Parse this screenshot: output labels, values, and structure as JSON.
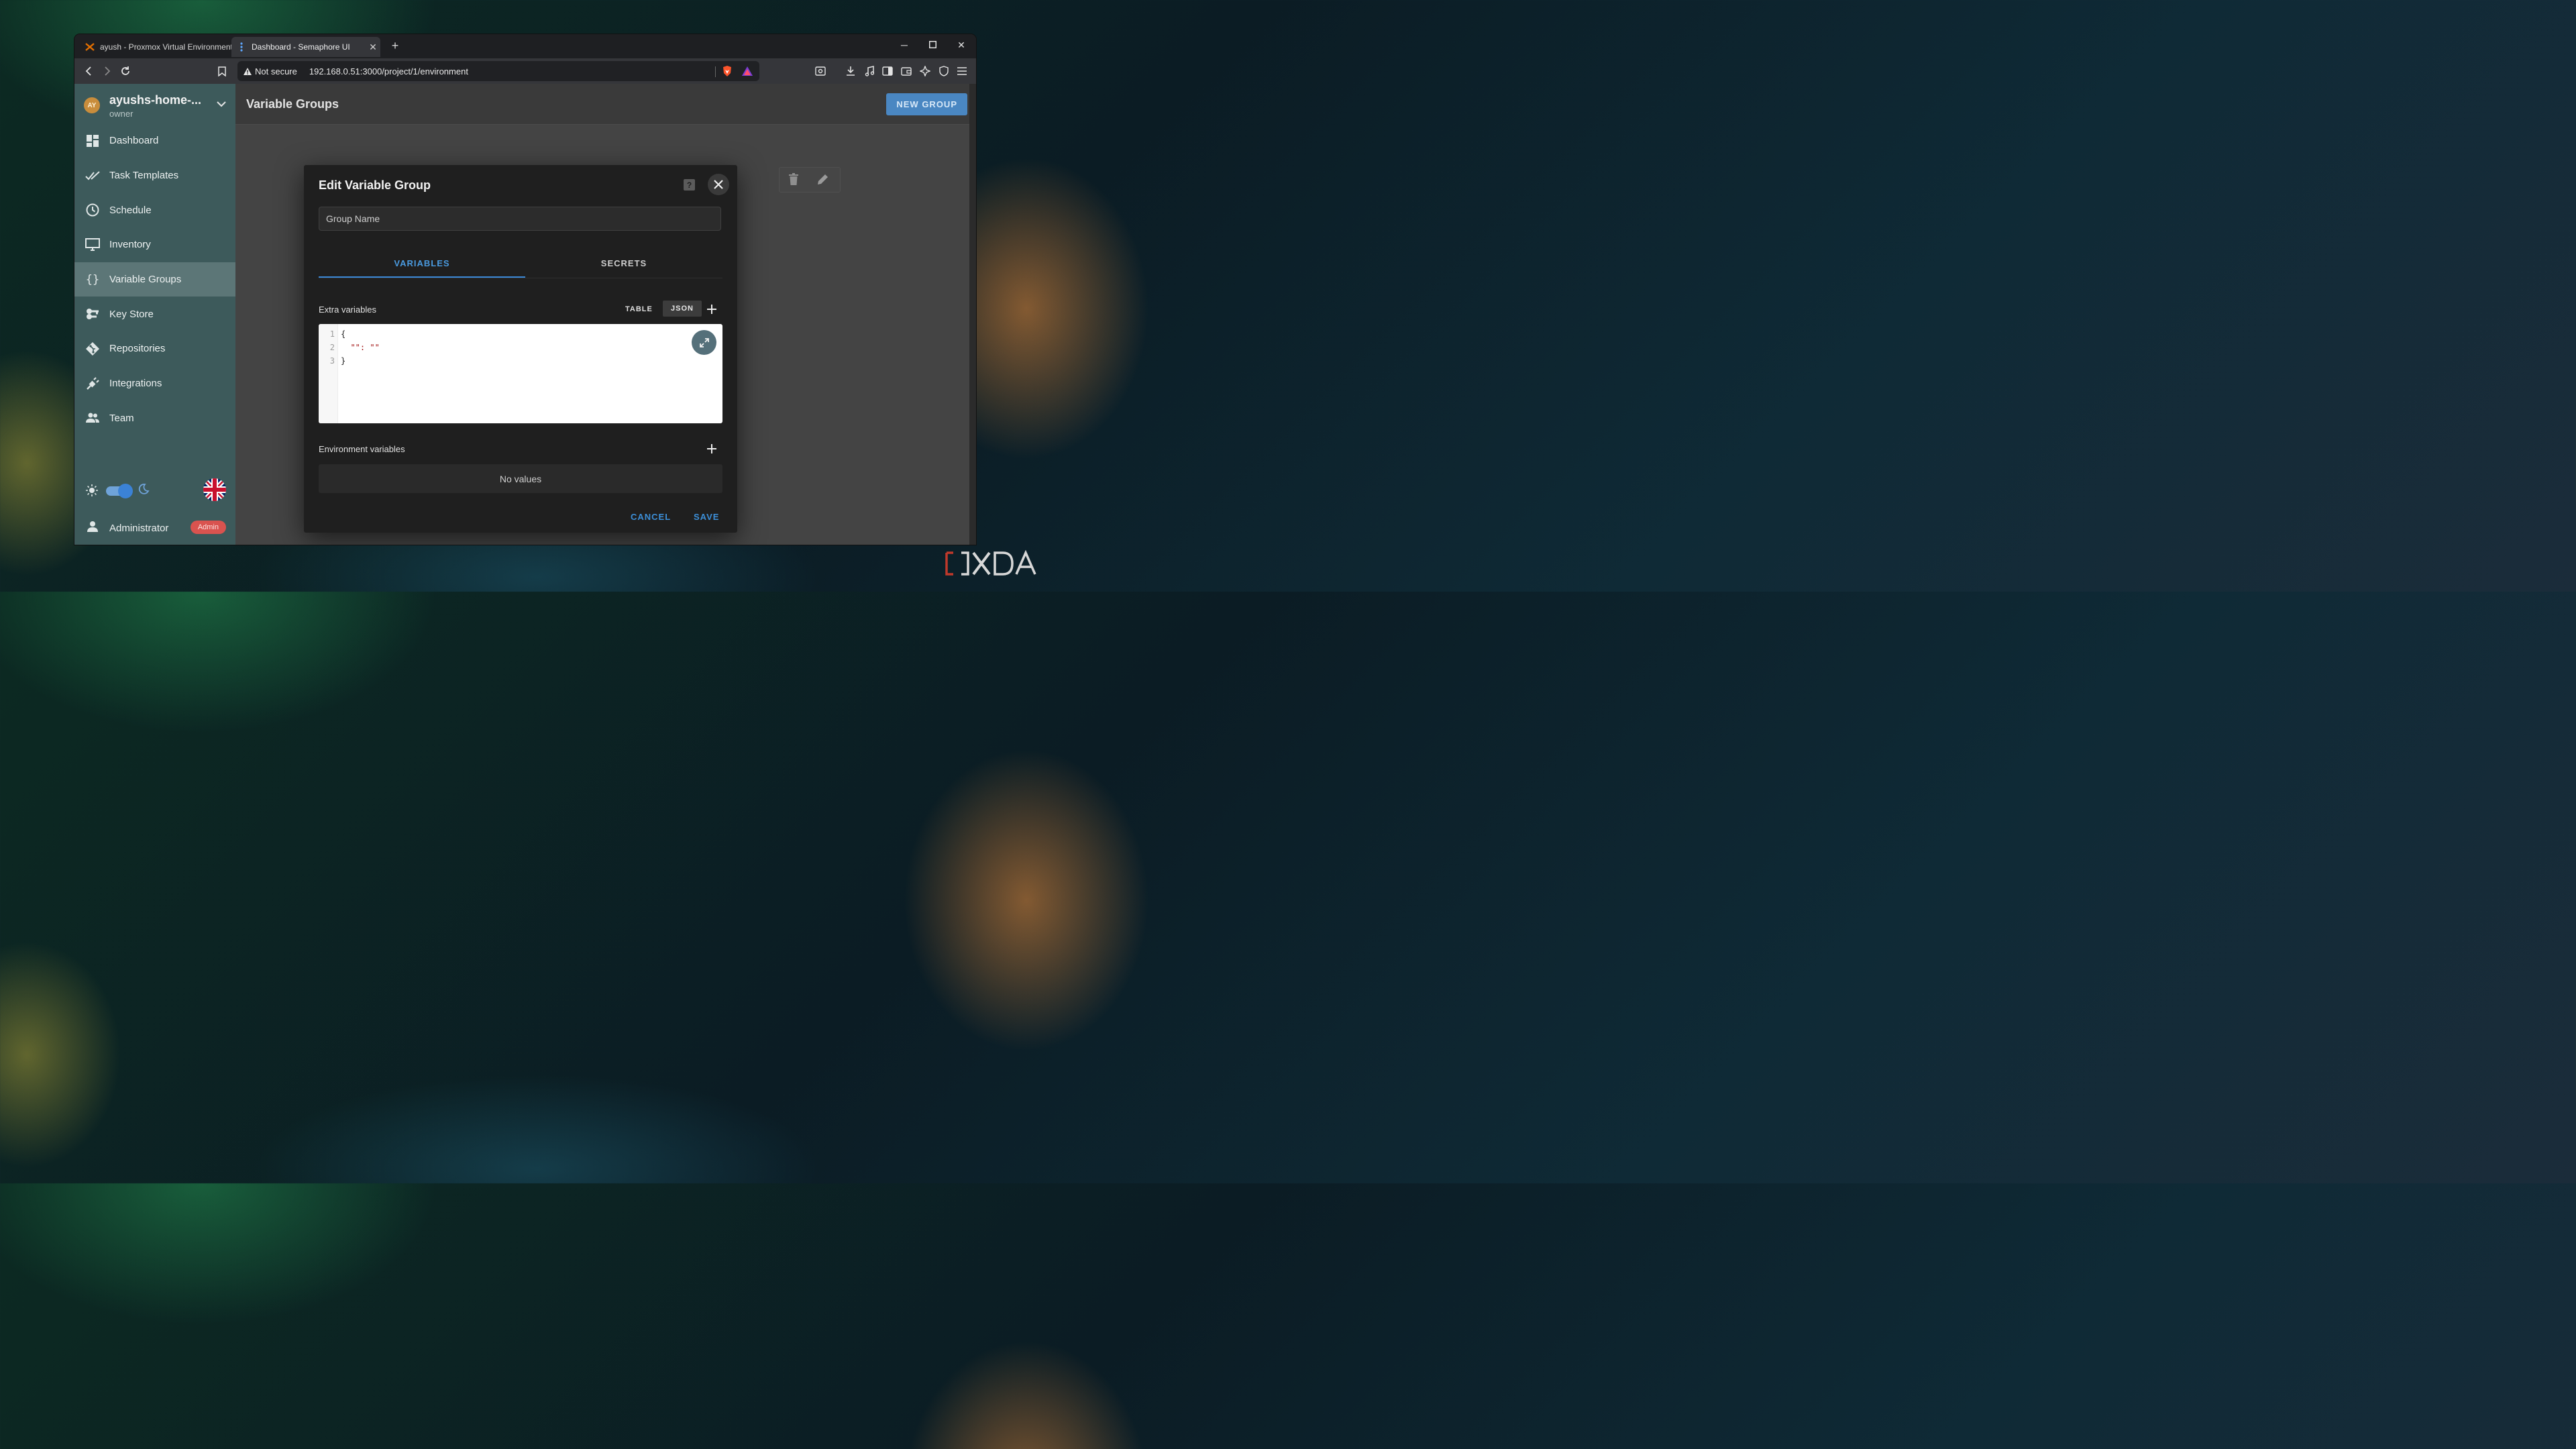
{
  "browser": {
    "tabs": [
      {
        "title": "ayush - Proxmox Virtual Environment",
        "active": false
      },
      {
        "title": "Dashboard - Semaphore UI",
        "active": true
      }
    ],
    "security_label": "Not secure",
    "url": "192.168.0.51:3000/project/1/environment"
  },
  "sidebar": {
    "project": {
      "avatar": "AY",
      "name": "ayushs-home-...",
      "role": "owner"
    },
    "items": [
      {
        "label": "Dashboard",
        "icon": "dashboard-icon"
      },
      {
        "label": "Task Templates",
        "icon": "double-check-icon"
      },
      {
        "label": "Schedule",
        "icon": "clock-icon"
      },
      {
        "label": "Inventory",
        "icon": "monitor-icon"
      },
      {
        "label": "Variable Groups",
        "icon": "braces-icon",
        "active": true
      },
      {
        "label": "Key Store",
        "icon": "key-icon"
      },
      {
        "label": "Repositories",
        "icon": "git-icon"
      },
      {
        "label": "Integrations",
        "icon": "plug-icon"
      },
      {
        "label": "Team",
        "icon": "team-icon"
      }
    ],
    "dark_mode": true,
    "user": {
      "name": "Administrator",
      "badge": "Admin"
    }
  },
  "main": {
    "title": "Variable Groups",
    "new_group_label": "NEW GROUP"
  },
  "dialog": {
    "title": "Edit Variable Group",
    "group_name_placeholder": "Group Name",
    "tabs": [
      "VARIABLES",
      "SECRETS"
    ],
    "extra_vars_label": "Extra variables",
    "view_table": "TABLE",
    "view_json": "JSON",
    "editor_lines": [
      "{",
      "  \"\": \"\"",
      "}"
    ],
    "env_vars_label": "Environment variables",
    "no_values": "No values",
    "cancel_label": "CANCEL",
    "save_label": "SAVE"
  },
  "colors": {
    "sidebar_bg": "#3d5a5b",
    "accent": "#3b88d6",
    "admin_badge": "#d9534f",
    "new_group_btn": "#4a87c2"
  }
}
